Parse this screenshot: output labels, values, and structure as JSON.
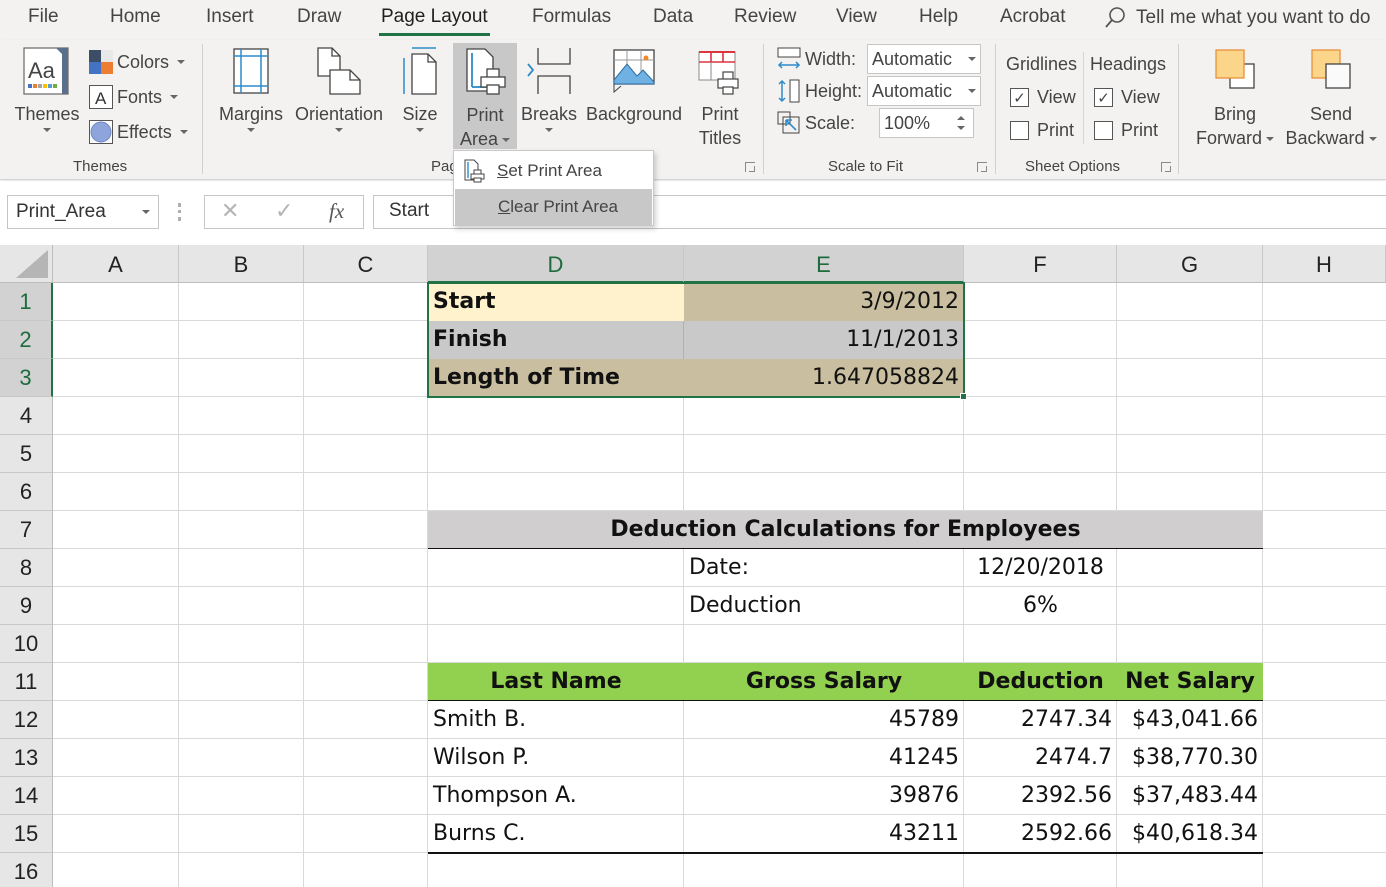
{
  "ribbon_tabs": [
    "File",
    "Home",
    "Insert",
    "Draw",
    "Page Layout",
    "Formulas",
    "Data",
    "Review",
    "View",
    "Help",
    "Acrobat"
  ],
  "active_tab": "Page Layout",
  "tell_me": "Tell me what you want to do",
  "themes_group": {
    "label": "Themes",
    "themes_btn": "Themes",
    "colors": "Colors",
    "fonts": "Fonts",
    "effects": "Effects"
  },
  "page_setup_group": {
    "label": "Page Setup",
    "label_visible": "Pag",
    "margins": "Margins",
    "orientation": "Orientation",
    "size": "Size",
    "print_area_line1": "Print",
    "print_area_line2": "Area",
    "breaks": "Breaks",
    "background": "Background",
    "print_titles_line1": "Print",
    "print_titles_line2": "Titles"
  },
  "print_area_menu": {
    "set_u": "S",
    "set_rest": "et Print Area",
    "clear_u": "C",
    "clear_rest": "lear Print Area"
  },
  "scale_group": {
    "label": "Scale to Fit",
    "width_label": "Width:",
    "width_value": "Automatic",
    "height_label": "Height:",
    "height_value": "Automatic",
    "scale_label": "Scale:",
    "scale_value": "100%"
  },
  "sheet_options_group": {
    "label": "Sheet Options",
    "gridlines": "Gridlines",
    "headings": "Headings",
    "view": "View",
    "print": "Print",
    "gridlines_view": true,
    "gridlines_print": false,
    "headings_view": true,
    "headings_print": false
  },
  "arrange_group": {
    "bring_line1": "Bring",
    "bring_line2": "Forward",
    "send_line1": "Send",
    "send_line2": "Backward"
  },
  "formula_bar": {
    "name_box": "Print_Area",
    "cancel": "✕",
    "enter": "✓",
    "fx": "fx",
    "value": "Start"
  },
  "columns": [
    "A",
    "B",
    "C",
    "D",
    "E",
    "F",
    "G",
    "H"
  ],
  "rows": [
    "1",
    "2",
    "3",
    "4",
    "5",
    "6",
    "7",
    "8",
    "9",
    "10",
    "11",
    "12",
    "13",
    "14",
    "15",
    "16"
  ],
  "cells": {
    "D1": "Start",
    "E1": "3/9/2012",
    "D2": "Finish",
    "E2": "11/1/2013",
    "D3": "Length of Time",
    "E3": "1.647058824",
    "D7": "Deduction Calculations for Employees",
    "E8": "Date:",
    "F8": "12/20/2018",
    "E9": "Deduction",
    "F9": "6%",
    "D11": "Last Name",
    "E11": "Gross Salary",
    "F11": "Deduction",
    "G11": "Net Salary",
    "D12": "Smith B.",
    "E12": "45789",
    "F12": "2747.34",
    "G12": "$43,041.66",
    "D13": "Wilson P.",
    "E13": "41245",
    "F13": "2474.7",
    "G13": "$38,770.30",
    "D14": "Thompson A.",
    "E14": "39876",
    "F14": "2392.56",
    "G14": "$37,483.44",
    "D15": "Burns C.",
    "E15": "43211",
    "F15": "2592.66",
    "G15": "$40,618.34"
  },
  "colors": {
    "accent": "#217346",
    "start_label_fill": "#fff2cc",
    "tan_fill": "#c9bfa0",
    "gray_fill": "#c9c9c9",
    "title_fill": "#d0cece",
    "header_green": "#92d050"
  }
}
